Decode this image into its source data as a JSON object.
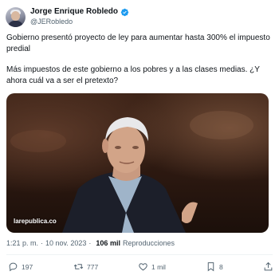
{
  "user": {
    "display_name": "Jorge Enrique Robledo",
    "handle": "@JERobledo",
    "verified": true,
    "verified_color": "#1d9bf0"
  },
  "tweet": {
    "paragraphs": [
      "Gobierno presentó proyecto de ley para aumentar hasta 300% el impuesto predial",
      "Más impuestos de este gobierno a los pobres y a las clases medias. ¿Y ahora cuál va a ser el pretexto?"
    ]
  },
  "media": {
    "watermark": "larepublica.co"
  },
  "meta": {
    "time": "1:21 p. m.",
    "separator": "·",
    "date": "10 nov. 2023",
    "views": "106 mil",
    "views_label": "Reproducciones"
  },
  "actions": {
    "reply_count": "197",
    "retweet_count": "777",
    "like_count": "1 mil",
    "bookmark_count": "8"
  },
  "icons": {
    "reply": "reply-icon",
    "retweet": "retweet-icon",
    "like": "heart-icon",
    "bookmark": "bookmark-icon",
    "share": "share-icon"
  }
}
